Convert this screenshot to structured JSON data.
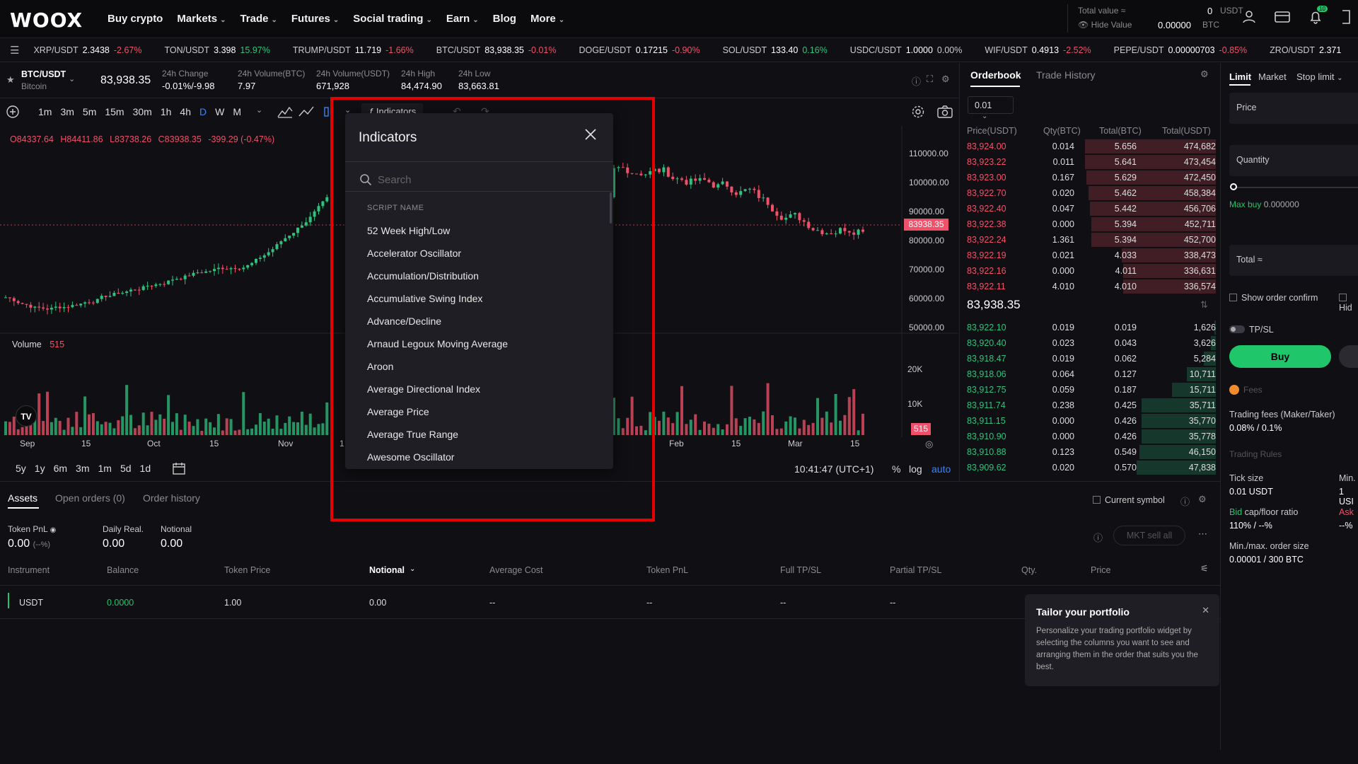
{
  "nav": {
    "logo": "WOOX",
    "items": [
      {
        "label": "Buy crypto",
        "dropdown": false
      },
      {
        "label": "Markets",
        "dropdown": true
      },
      {
        "label": "Trade",
        "dropdown": true
      },
      {
        "label": "Futures",
        "dropdown": true
      },
      {
        "label": "Social trading",
        "dropdown": true
      },
      {
        "label": "Earn",
        "dropdown": true
      },
      {
        "label": "Blog",
        "dropdown": false
      },
      {
        "label": "More",
        "dropdown": true
      }
    ],
    "total_value_label": "Total value",
    "total_value_usdt": "0",
    "usdt": "USDT",
    "hide_value": "Hide Value",
    "total_value_btc": "0.00000",
    "btc": "BTC",
    "notif_count": "10"
  },
  "ticker": [
    {
      "pair": "XRP/USDT",
      "price": "2.3438",
      "change": "-2.67%",
      "dir": "neg"
    },
    {
      "pair": "TON/USDT",
      "price": "3.398",
      "change": "15.97%",
      "dir": "pos"
    },
    {
      "pair": "TRUMP/USDT",
      "price": "11.719",
      "change": "-1.66%",
      "dir": "neg"
    },
    {
      "pair": "BTC/USDT",
      "price": "83,938.35",
      "change": "-0.01%",
      "dir": "neg"
    },
    {
      "pair": "DOGE/USDT",
      "price": "0.17215",
      "change": "-0.90%",
      "dir": "neg"
    },
    {
      "pair": "SOL/USDT",
      "price": "133.40",
      "change": "0.16%",
      "dir": "pos"
    },
    {
      "pair": "USDC/USDT",
      "price": "1.0000",
      "change": "0.00%",
      "dir": "zero"
    },
    {
      "pair": "WIF/USDT",
      "price": "0.4913",
      "change": "-2.52%",
      "dir": "neg"
    },
    {
      "pair": "PEPE/USDT",
      "price": "0.00000703",
      "change": "-0.85%",
      "dir": "neg"
    },
    {
      "pair": "ZRO/USDT",
      "price": "2.371",
      "change": "",
      "dir": "zero"
    }
  ],
  "symbol": {
    "pair": "BTC/USDT",
    "name": "Bitcoin",
    "price": "83,938.35",
    "stats": [
      {
        "label": "24h Change",
        "value": "-0.01%/-9.98",
        "color": "#f0516a"
      },
      {
        "label": "24h Volume(BTC)",
        "value": "7.97",
        "color": "#ffffff"
      },
      {
        "label": "24h Volume(USDT)",
        "value": "671,928",
        "color": "#ffffff"
      },
      {
        "label": "24h High",
        "value": "84,474.90",
        "color": "#ffffff"
      },
      {
        "label": "24h Low",
        "value": "83,663.81",
        "color": "#ffffff"
      }
    ]
  },
  "toolbar": {
    "intervals": [
      "1m",
      "3m",
      "5m",
      "15m",
      "30m",
      "1h",
      "4h",
      "D",
      "W",
      "M"
    ],
    "active_interval": "D",
    "indicators_label": "Indicators"
  },
  "ohlc": {
    "o": "O84337.64",
    "h": "H84411.86",
    "l": "L83738.26",
    "c": "C83938.35",
    "chg": "-399.29 (-0.47%)"
  },
  "chart": {
    "price_axis": [
      "110000.00",
      "100000.00",
      "90000.00",
      "80000.00",
      "70000.00",
      "60000.00",
      "50000.00"
    ],
    "current_price_tag": "83938.35",
    "volume_label": "Volume",
    "volume_value": "515",
    "volume_axis": [
      "20K",
      "10K"
    ],
    "volume_tag": "515",
    "time_axis": [
      "Sep",
      "15",
      "Oct",
      "15",
      "Nov",
      "1",
      "Feb",
      "15",
      "Mar",
      "15"
    ]
  },
  "bottombar": {
    "ranges": [
      "5y",
      "1y",
      "6m",
      "3m",
      "1m",
      "5d",
      "1d"
    ],
    "clock": "10:41:47 (UTC+1)",
    "pct": "%",
    "log": "log",
    "auto": "auto"
  },
  "indicators": {
    "title": "Indicators",
    "search_placeholder": "Search",
    "section": "SCRIPT NAME",
    "items": [
      "52 Week High/Low",
      "Accelerator Oscillator",
      "Accumulation/Distribution",
      "Accumulative Swing Index",
      "Advance/Decline",
      "Arnaud Legoux Moving Average",
      "Aroon",
      "Average Directional Index",
      "Average Price",
      "Average True Range",
      "Awesome Oscillator"
    ]
  },
  "orderbook": {
    "tabs": [
      "Orderbook",
      "Trade History"
    ],
    "tick": "0.01",
    "headers": [
      "Price(USDT)",
      "Qty(BTC)",
      "Total(BTC)",
      "Total(USDT)"
    ],
    "asks": [
      [
        "83,924.00",
        "0.014",
        "5.656",
        "474,682"
      ],
      [
        "83,923.22",
        "0.011",
        "5.641",
        "473,454"
      ],
      [
        "83,923.00",
        "0.167",
        "5.629",
        "472,450"
      ],
      [
        "83,922.70",
        "0.020",
        "5.462",
        "458,384"
      ],
      [
        "83,922.40",
        "0.047",
        "5.442",
        "456,706"
      ],
      [
        "83,922.38",
        "0.000",
        "5.394",
        "452,711"
      ],
      [
        "83,922.24",
        "1.361",
        "5.394",
        "452,700"
      ],
      [
        "83,922.19",
        "0.021",
        "4.033",
        "338,473"
      ],
      [
        "83,922.16",
        "0.000",
        "4.011",
        "336,631"
      ],
      [
        "83,922.11",
        "4.010",
        "4.010",
        "336,574"
      ]
    ],
    "ask_depth": [
      0.99,
      0.99,
      0.98,
      0.96,
      0.95,
      0.94,
      0.94,
      0.71,
      0.7,
      0.7
    ],
    "mid": "83,938.35",
    "bids": [
      [
        "83,922.10",
        "0.019",
        "0.019",
        "1,626"
      ],
      [
        "83,920.40",
        "0.023",
        "0.043",
        "3,626"
      ],
      [
        "83,918.47",
        "0.019",
        "0.062",
        "5,284"
      ],
      [
        "83,918.06",
        "0.064",
        "0.127",
        "10,711"
      ],
      [
        "83,912.75",
        "0.059",
        "0.187",
        "15,711"
      ],
      [
        "83,911.74",
        "0.238",
        "0.425",
        "35,711"
      ],
      [
        "83,911.15",
        "0.000",
        "0.426",
        "35,770"
      ],
      [
        "83,910.90",
        "0.000",
        "0.426",
        "35,778"
      ],
      [
        "83,910.88",
        "0.123",
        "0.549",
        "46,150"
      ],
      [
        "83,909.62",
        "0.020",
        "0.570",
        "47,838"
      ]
    ],
    "bid_depth": [
      0.01,
      0.04,
      0.09,
      0.22,
      0.33,
      0.56,
      0.56,
      0.56,
      0.58,
      0.6
    ]
  },
  "order": {
    "tabs": [
      "Limit",
      "Market",
      "Stop limit"
    ],
    "price_label": "Price",
    "quantity_label": "Quantity",
    "max_buy": "Max buy",
    "max_buy_value": "0.000000",
    "total_label": "Total",
    "show_confirm": "Show order confirm",
    "hidden": "Hid",
    "tpsl": "TP/SL",
    "buy": "Buy",
    "fees": "Fees",
    "fees_label": "Trading fees (Maker/Taker)",
    "fees_value": "0.08% / 0.1%",
    "rules": "Trading Rules",
    "tick_label": "Tick size",
    "tick_value": "0.01 USDT",
    "min_label": "Min.",
    "min_value": "1 USI",
    "bid_word": "Bid",
    "bid_rest": "cap/floor ratio",
    "bid_value": "110% / --%",
    "ask_label": "Ask",
    "ask_value": "--%",
    "minmax_label": "Min./max. order size",
    "minmax_value": "0.00001 / 300 BTC"
  },
  "assets": {
    "tabs": [
      "Assets",
      "Open orders (0)",
      "Order history"
    ],
    "current_symbol": "Current symbol",
    "mkt_sell": "MKT sell all",
    "pnl_items": [
      {
        "label": "Token PnL",
        "value": "0.00",
        "sub": "(--%)"
      },
      {
        "label": "Daily Real.",
        "value": "0.00",
        "sub": ""
      },
      {
        "label": "Notional",
        "value": "0.00",
        "sub": ""
      }
    ],
    "columns": [
      "Instrument",
      "Balance",
      "Token Price",
      "Notional",
      "Average Cost",
      "Token PnL",
      "Full TP/SL",
      "Partial TP/SL",
      "Qty.",
      "Price"
    ],
    "row": [
      "USDT",
      "0.0000",
      "1.00",
      "0.00",
      "--",
      "--",
      "--",
      "--"
    ]
  },
  "tailor": {
    "title": "Tailor your portfolio",
    "body": "Personalize your trading portfolio widget by selecting the columns you want to see and arranging them in the order that suits you the best."
  },
  "colors": {
    "up": "#2ec27e",
    "down": "#f0516a",
    "accent": "#1fc76a",
    "panel": "#1e1e24",
    "highlight": "#e60000"
  }
}
